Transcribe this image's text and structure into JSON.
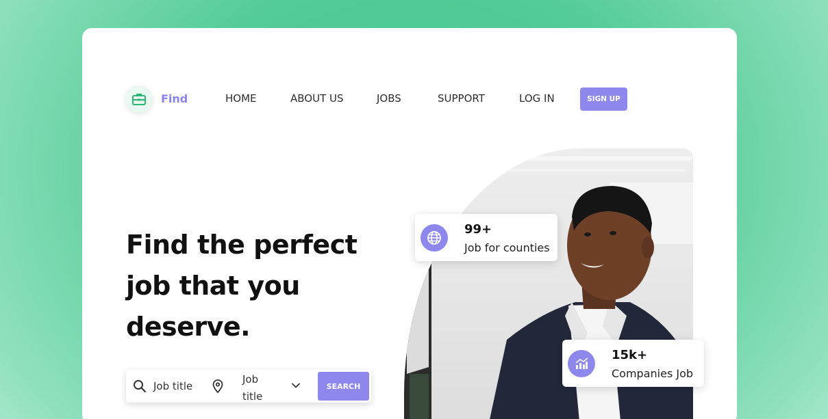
{
  "brand": {
    "name": "Find",
    "icon": "briefcase-icon"
  },
  "nav": {
    "items": [
      {
        "label": "HOME"
      },
      {
        "label": "ABOUT US"
      },
      {
        "label": "JOBS"
      },
      {
        "label": "SUPPORT"
      },
      {
        "label": "LOG IN"
      }
    ],
    "signup_label": "SIGN UP"
  },
  "hero": {
    "headline_lines": [
      "Find the perfect",
      "job that you",
      "deserve."
    ]
  },
  "search": {
    "job_title_placeholder": "Job title",
    "location_select_value": "Job title",
    "button_label": "SEARCH"
  },
  "stats": [
    {
      "value": "99+",
      "label": "Job for counties",
      "icon": "globe-icon"
    },
    {
      "value": "15k+",
      "label": "Companies Job",
      "icon": "chart-icon"
    }
  ],
  "colors": {
    "accent": "#8e87ec",
    "brand_green": "#3ec48d",
    "background": "#55cc98"
  }
}
